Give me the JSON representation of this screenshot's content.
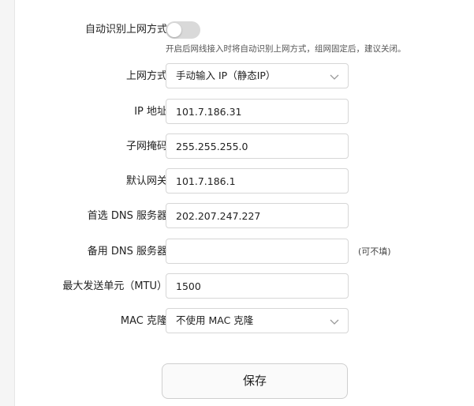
{
  "auto_detect": {
    "label": "自动识别上网方式",
    "enabled": false,
    "hint": "开启后网线接入时将自动识别上网方式，组网固定后，建议关闭。"
  },
  "form": {
    "connection_type": {
      "label": "上网方式",
      "value": "手动输入 IP（静态IP）"
    },
    "ip_address": {
      "label": "IP 地址",
      "value": "101.7.186.31"
    },
    "subnet_mask": {
      "label": "子网掩码",
      "value": "255.255.255.0"
    },
    "gateway": {
      "label": "默认网关",
      "value": "101.7.186.1"
    },
    "primary_dns": {
      "label": "首选 DNS 服务器",
      "value": "202.207.247.227"
    },
    "secondary_dns": {
      "label": "备用 DNS 服务器",
      "value": "",
      "note": "(可不填)"
    },
    "mtu": {
      "label": "最大发送单元（MTU）",
      "value": "1500"
    },
    "mac_clone": {
      "label": "MAC 克隆",
      "value": "不使用 MAC 克隆"
    }
  },
  "save_label": "保存",
  "icons": {
    "chevron": "chevron-down-icon"
  },
  "colors": {
    "toggle_off": "#d9d9d9",
    "border": "#d6d6d6"
  }
}
